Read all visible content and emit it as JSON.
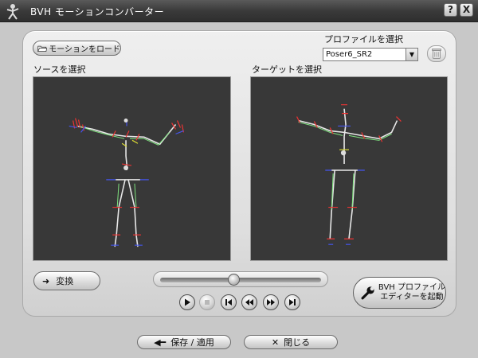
{
  "window": {
    "title": "BVH モーションコンバーター",
    "help_label": "?",
    "close_label": "X"
  },
  "toolbar": {
    "load_motion_label": "モーションをロード"
  },
  "profile": {
    "label": "プロファイルを選択",
    "selected": "Poser6_SR2"
  },
  "source": {
    "label": "ソースを選択"
  },
  "target": {
    "label": "ターゲットを選択"
  },
  "controls": {
    "convert_label": "変換",
    "timeline_fraction": 0.46,
    "editor_line1": "BVH プロファイル",
    "editor_line2": "エディターを起動"
  },
  "footer": {
    "save_label": "保存 / 適用",
    "close_label": "閉じる"
  },
  "icons": {
    "app": "figure-icon",
    "load": "folder-icon",
    "trash": "trash-icon",
    "convert": "arrow-right-icon",
    "editor": "wrench-icon",
    "save": "arrow-left-icon",
    "close": "close-icon"
  },
  "colors": {
    "titlebar": "#3a3a3a",
    "viewport": "#383838",
    "panel": "#e4e4e4"
  }
}
